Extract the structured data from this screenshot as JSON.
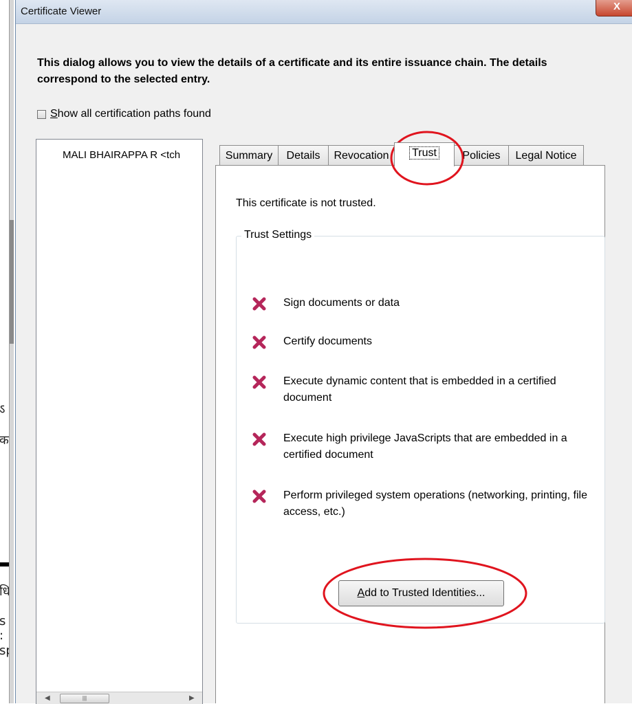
{
  "window": {
    "title": "Certificate Viewer",
    "close_glyph": "X"
  },
  "description": "This dialog allows you to view the details of a certificate and its entire issuance chain. The details correspond to the selected entry.",
  "show_paths": {
    "mnemonic": "S",
    "label_rest": "how all certification paths found",
    "checked": false
  },
  "cert_list": {
    "entry": "MALI BHAIRAPPA R <tch"
  },
  "tabs": [
    {
      "label": "Summary"
    },
    {
      "label": "Details"
    },
    {
      "label": "Revocation"
    },
    {
      "label": "Trust",
      "active": true
    },
    {
      "label": "Policies"
    },
    {
      "label": "Legal Notice"
    }
  ],
  "trust": {
    "status": "This certificate is not trusted.",
    "group_label": "Trust Settings",
    "items": [
      {
        "text": "Sign documents or data",
        "icon": "red-x-icon"
      },
      {
        "text": "Certify documents",
        "icon": "red-x-icon"
      },
      {
        "text": "Execute dynamic content that is embedded in a certified document",
        "icon": "red-x-icon"
      },
      {
        "text": "Execute high privilege JavaScripts that are embedded in a certified document",
        "icon": "red-x-icon"
      },
      {
        "text": "Perform privileged system operations (networking, printing, file access, etc.)",
        "icon": "red-x-icon"
      }
    ],
    "add_button": {
      "mnemonic": "A",
      "label_rest": "dd to Trusted Identities..."
    }
  },
  "background_glyphs": [
    "ऽ",
    "क",
    "धि",
    "s :",
    "sp"
  ],
  "colors": {
    "x_icon": "#b5265a",
    "annotation": "#e0141e"
  }
}
